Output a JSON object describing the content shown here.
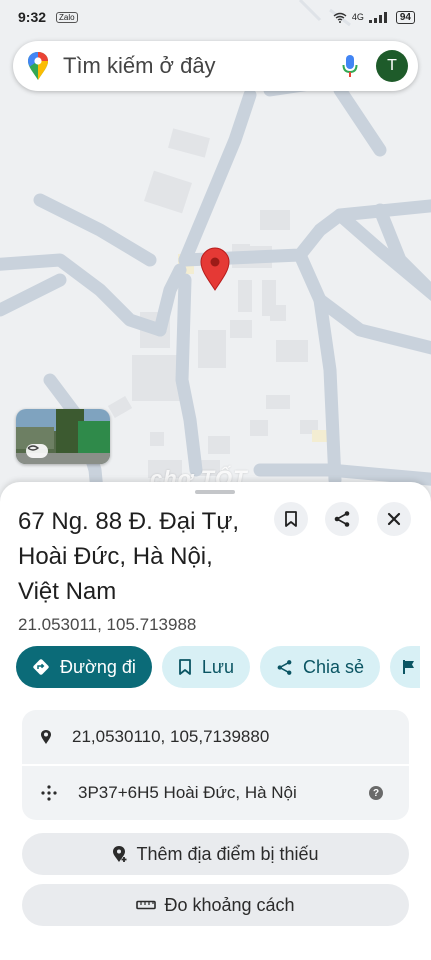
{
  "status_bar": {
    "time": "9:32",
    "app_badge": "Zalo",
    "network": "4G",
    "battery": "94"
  },
  "search": {
    "placeholder": "Tìm kiếm ở đây",
    "avatar_letter": "T"
  },
  "map": {
    "watermark": "chợ TỐT"
  },
  "place": {
    "title_lines": [
      "67 Ng. 88 Đ. Đại Tự,",
      "Hoài Đức, Hà Nội,",
      "Việt Nam"
    ],
    "coordinates": "21.053011, 105.713988"
  },
  "actions": {
    "directions": "Đường đi",
    "save": "Lưu",
    "share": "Chia sẻ"
  },
  "details": {
    "decimal_coords": "21,0530110, 105,7139880",
    "plus_code": "3P37+6H5 Hoài Đức, Hà Nội"
  },
  "buttons": {
    "add_missing_place": "Thêm địa điểm bị thiếu",
    "measure_distance": "Đo khoảng cách"
  },
  "colors": {
    "accent": "#0b6b78",
    "chip_bg": "#d8f0f5",
    "pin": "#e53935",
    "road": "#c9d2dc"
  }
}
